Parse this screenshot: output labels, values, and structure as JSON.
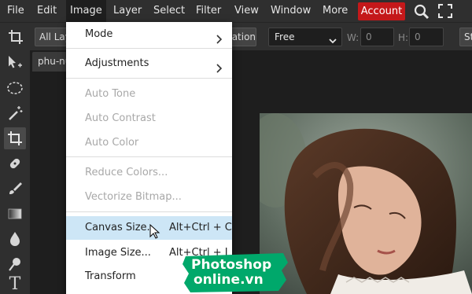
{
  "menubar": {
    "items": [
      "File",
      "Edit",
      "Image",
      "Layer",
      "Select",
      "Filter",
      "View",
      "Window",
      "More"
    ],
    "open_menu": "Image",
    "account_label": "Account"
  },
  "options_bar": {
    "layers_select": "All Layers",
    "apply_button": "Transformation",
    "ratio_value": "Free",
    "w_label": "W:",
    "w_value": "0",
    "h_label": "H:",
    "h_value": "0",
    "straighten_button": "Straighten"
  },
  "document": {
    "tab_name": "phu-nu.jpg"
  },
  "image_menu": {
    "items": [
      {
        "label": "Mode",
        "has_submenu": true,
        "disabled": false
      },
      {
        "label": "Adjustments",
        "has_submenu": true,
        "disabled": false
      },
      {
        "label": "Auto Tone",
        "disabled": true
      },
      {
        "label": "Auto Contrast",
        "disabled": true
      },
      {
        "label": "Auto Color",
        "disabled": true
      },
      {
        "label": "Reduce Colors...",
        "disabled": true
      },
      {
        "label": "Vectorize Bitmap...",
        "disabled": true
      },
      {
        "label": "Canvas Size...",
        "shortcut": "Alt+Ctrl + C",
        "disabled": false,
        "hovered": true
      },
      {
        "label": "Image Size...",
        "shortcut": "Alt+Ctrl + I",
        "disabled": false
      },
      {
        "label": "Transform",
        "disabled": false
      }
    ]
  },
  "tools": [
    "move-tool",
    "marquee-tool",
    "magic-wand-tool",
    "crop-tool",
    "healing-tool",
    "brush-tool",
    "gradient-tool",
    "blur-tool",
    "smudge-tool",
    "text-tool"
  ],
  "text_tool_glyph": "T",
  "watermark": {
    "line1": "Photoshop",
    "line2": "online.vn"
  },
  "colors": {
    "accent_account": "#c4181a",
    "menu_hover": "#cde6f6",
    "watermark_green": "#00a86b"
  }
}
